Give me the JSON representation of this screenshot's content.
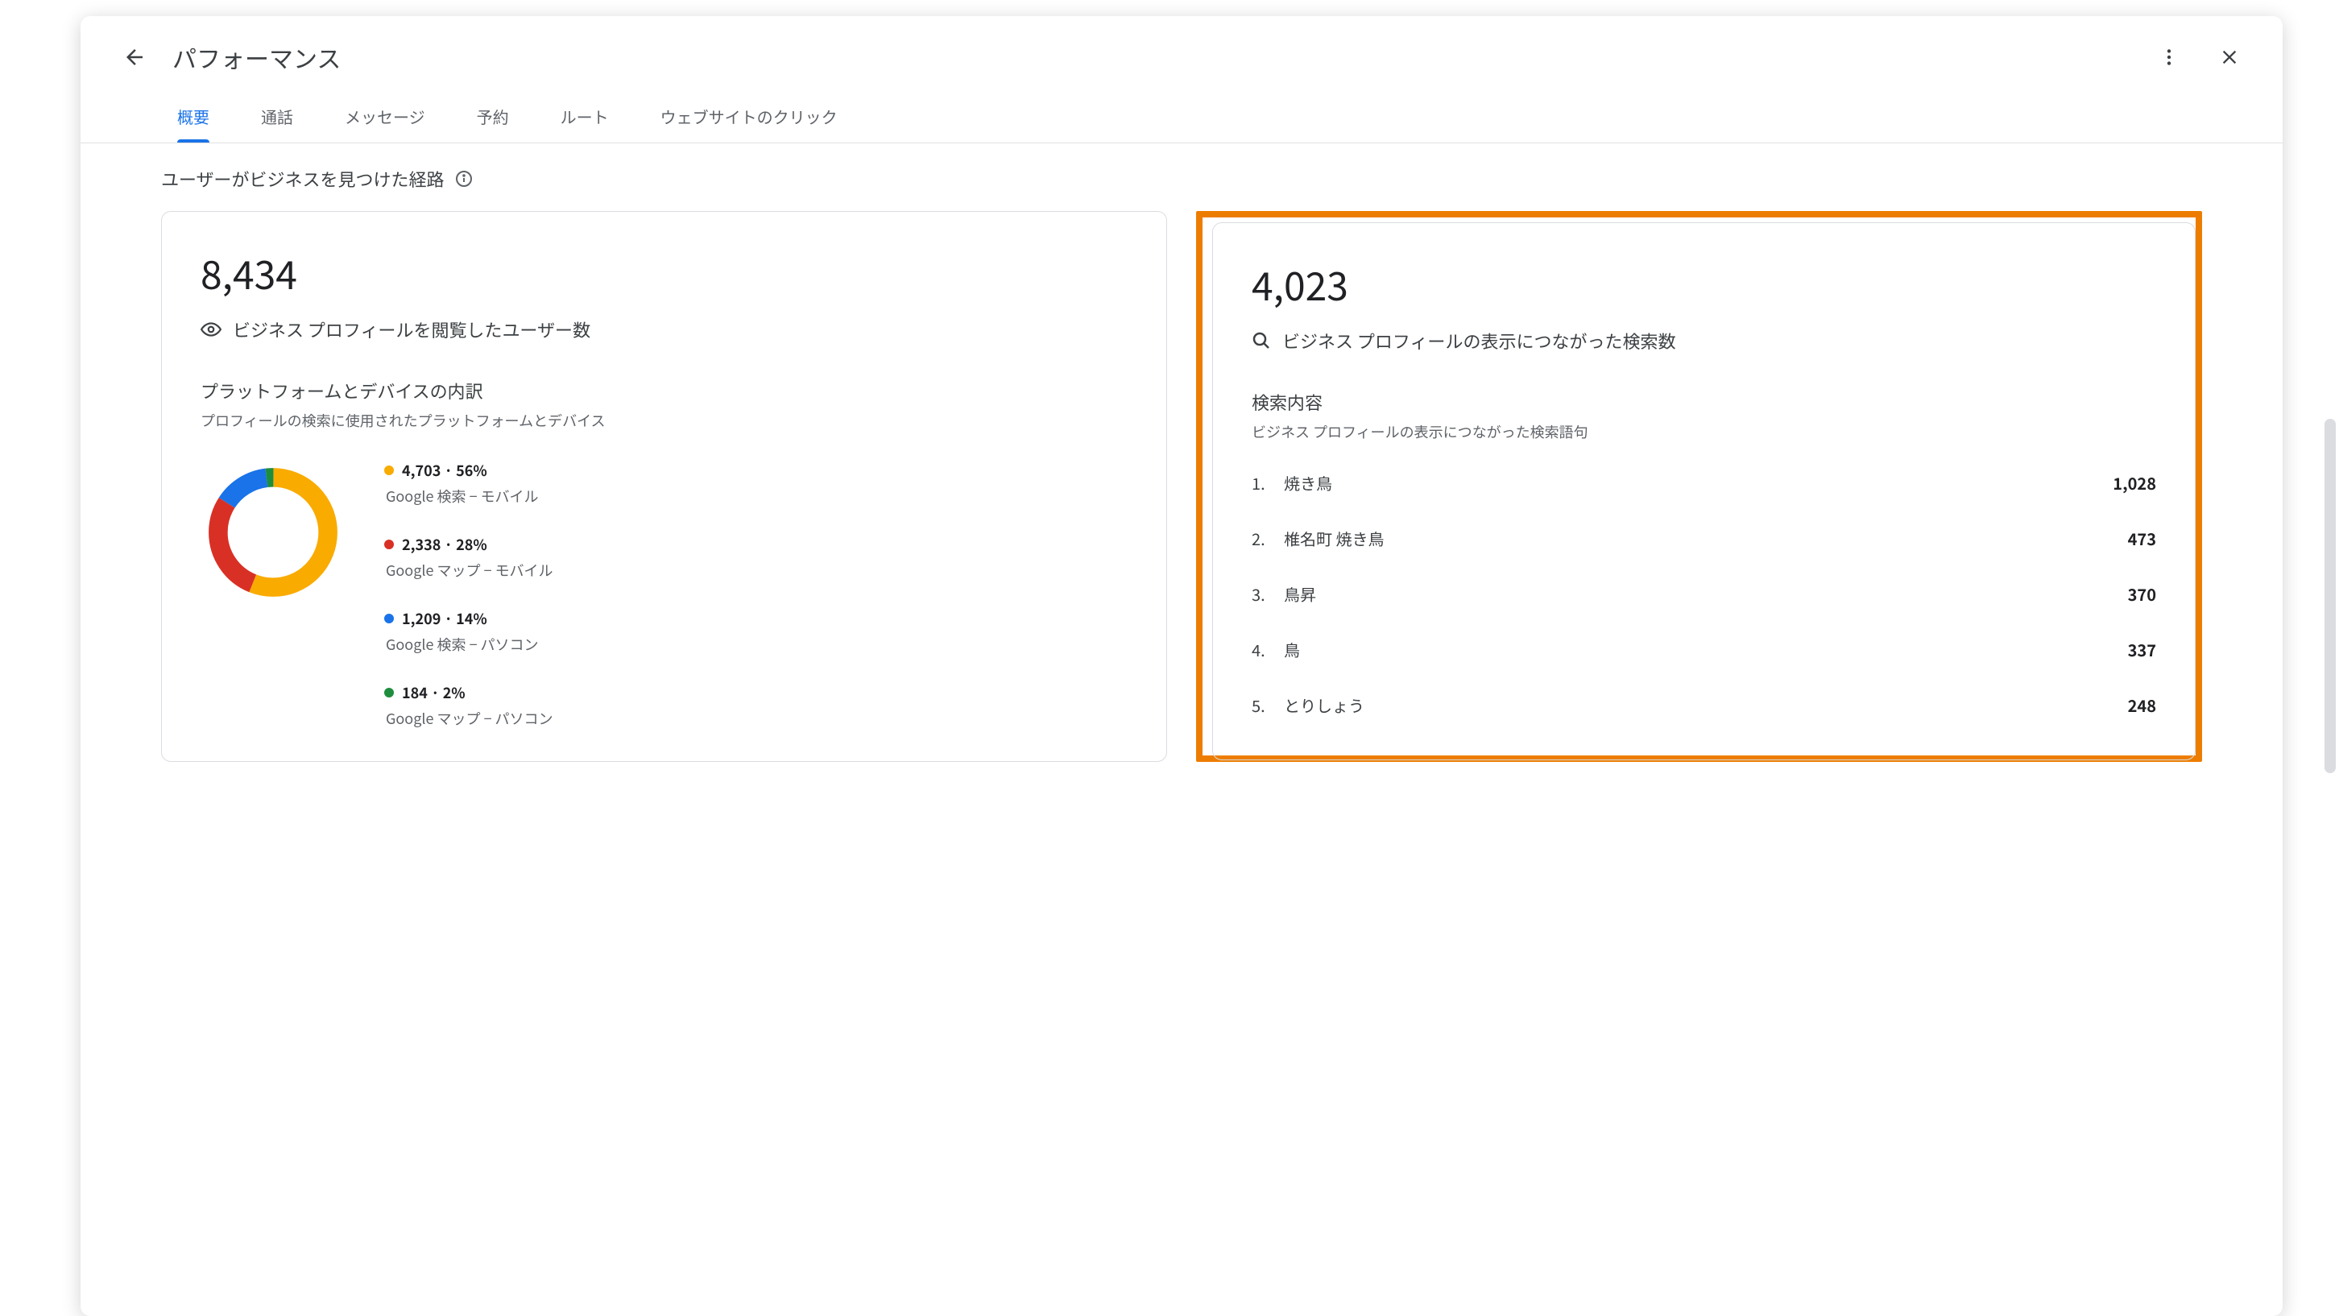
{
  "header": {
    "title": "パフォーマンス"
  },
  "tabs": [
    {
      "label": "概要",
      "active": true
    },
    {
      "label": "通話",
      "active": false
    },
    {
      "label": "メッセージ",
      "active": false
    },
    {
      "label": "予約",
      "active": false
    },
    {
      "label": "ルート",
      "active": false
    },
    {
      "label": "ウェブサイトのクリック",
      "active": false
    }
  ],
  "section_title": "ユーザーがビジネスを見つけた経路",
  "card_views": {
    "stat": "8,434",
    "label": "ビジネス プロフィールを閲覧したユーザー数",
    "breakdown_title": "プラットフォームとデバイスの内訳",
    "breakdown_desc": "プロフィールの検索に使用されたプラットフォームとデバイス",
    "legend": [
      {
        "value": "4,703 · 56%",
        "label": "Google 検索 − モバイル",
        "color": "#f9ab00"
      },
      {
        "value": "2,338 · 28%",
        "label": "Google マップ − モバイル",
        "color": "#d93025"
      },
      {
        "value": "1,209 · 14%",
        "label": "Google 検索 − パソコン",
        "color": "#1a73e8"
      },
      {
        "value": "184 · 2%",
        "label": "Google マップ − パソコン",
        "color": "#1e8e3e"
      }
    ]
  },
  "card_search": {
    "stat": "4,023",
    "label": "ビジネス プロフィールの表示につながった検索数",
    "sub_title": "検索内容",
    "sub_desc": "ビジネス プロフィールの表示につながった検索語句",
    "rows": [
      {
        "rank": "1.",
        "term": "焼き鳥",
        "count": "1,028"
      },
      {
        "rank": "2.",
        "term": "椎名町 焼き鳥",
        "count": "473"
      },
      {
        "rank": "3.",
        "term": "鳥昇",
        "count": "370"
      },
      {
        "rank": "4.",
        "term": "鳥",
        "count": "337"
      },
      {
        "rank": "5.",
        "term": "とりしょう",
        "count": "248"
      }
    ]
  },
  "chart_data": {
    "type": "pie",
    "title": "プラットフォームとデバイスの内訳",
    "series": [
      {
        "name": "Google 検索 − モバイル",
        "value": 4703,
        "percent": 56,
        "color": "#f9ab00"
      },
      {
        "name": "Google マップ − モバイル",
        "value": 2338,
        "percent": 28,
        "color": "#d93025"
      },
      {
        "name": "Google 検索 − パソコン",
        "value": 1209,
        "percent": 14,
        "color": "#1a73e8"
      },
      {
        "name": "Google マップ − パソコン",
        "value": 184,
        "percent": 2,
        "color": "#1e8e3e"
      }
    ]
  }
}
